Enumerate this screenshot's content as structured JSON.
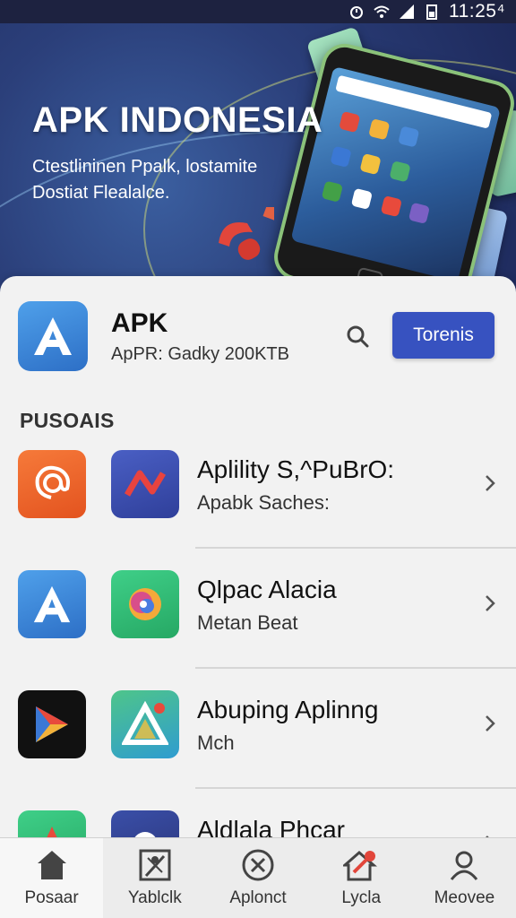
{
  "status_bar": {
    "time": "11:25⁴"
  },
  "hero": {
    "title": "APK INDONESIA",
    "subtitle": "Ctestlininen Ppalk, lostamite Dostiat Flealalce."
  },
  "app": {
    "name": "APK",
    "meta": "ApPR: Gadky 200KTB",
    "primary_button": "Torenis",
    "search_icon": "search-icon"
  },
  "section": {
    "title": "PUSOAIS"
  },
  "list": [
    {
      "title": "Aplility S,^PuBrO:",
      "subtitle": "Apabk Saches:"
    },
    {
      "title": "Qlpac Alacia",
      "subtitle": "Metan Beat"
    },
    {
      "title": "Abuping Aplinng",
      "subtitle": "Mch"
    },
    {
      "title": "Aldlala Phcar",
      "subtitle": ""
    }
  ],
  "bottom_nav": [
    {
      "label": "Posaar",
      "icon": "home-icon",
      "active": true
    },
    {
      "label": "Yablclk",
      "icon": "games-icon",
      "active": false
    },
    {
      "label": "Aplonct",
      "icon": "cancel-icon",
      "active": false
    },
    {
      "label": "Lycla",
      "icon": "house-key-icon",
      "active": false
    },
    {
      "label": "Meovee",
      "icon": "person-icon",
      "active": false
    }
  ],
  "colors": {
    "primary": "#3752c0",
    "hero_bg": "#2b3f7a"
  }
}
